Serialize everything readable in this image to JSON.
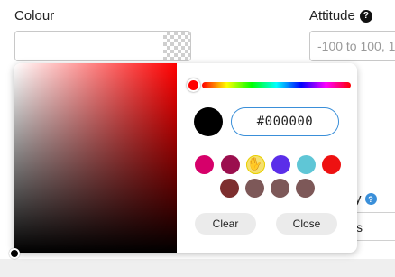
{
  "form": {
    "colour_label": "Colour",
    "attitude_label": "Attitude",
    "attitude_help": "?",
    "attitude_placeholder": "-100 to 100, 1",
    "background_help": "?",
    "partial_label_fragment": "y",
    "partial_field_fragment": "s"
  },
  "picker": {
    "hue_color": "#ff0000",
    "current_color": "#000000",
    "hex_value": "#000000",
    "swatches": [
      "#d6006a",
      "#9b0f4e",
      "#f5e06d",
      "#5b2ee9",
      "#5fc6d6",
      "#ee1111",
      "#7d2e2e",
      "#7d5858",
      "#7d5858",
      "#7d5858"
    ],
    "clear_label": "Clear",
    "close_label": "Close"
  }
}
